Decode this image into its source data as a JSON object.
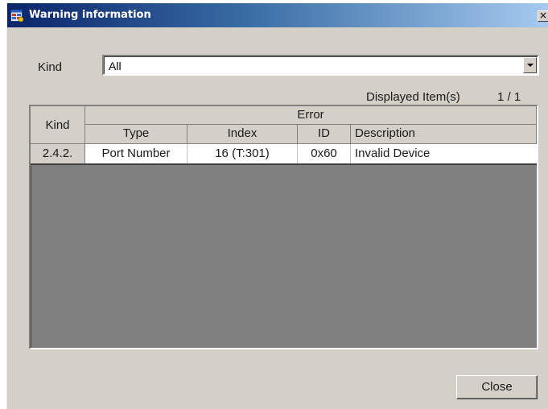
{
  "window": {
    "title": "Warning information",
    "close_glyph": "×",
    "icon": "warning-info-icon"
  },
  "filter": {
    "label": "Kind",
    "selected": "All"
  },
  "status": {
    "label": "Displayed Item(s)",
    "count": "1 / 1"
  },
  "table": {
    "group_header": "Error",
    "columns": {
      "kind": "Kind",
      "type": "Type",
      "index": "Index",
      "id": "ID",
      "description": "Description"
    },
    "rows": [
      {
        "kind": "2.4.2.",
        "type": "Port Number",
        "index": "16 (T:301)",
        "id": "0x60",
        "description": "Invalid Device"
      }
    ]
  },
  "footer": {
    "close_label": "Close"
  },
  "colors": {
    "title_start": "#0a246a",
    "title_end": "#a6caf0",
    "face": "#d4d0c8",
    "grid_empty": "#808080"
  }
}
